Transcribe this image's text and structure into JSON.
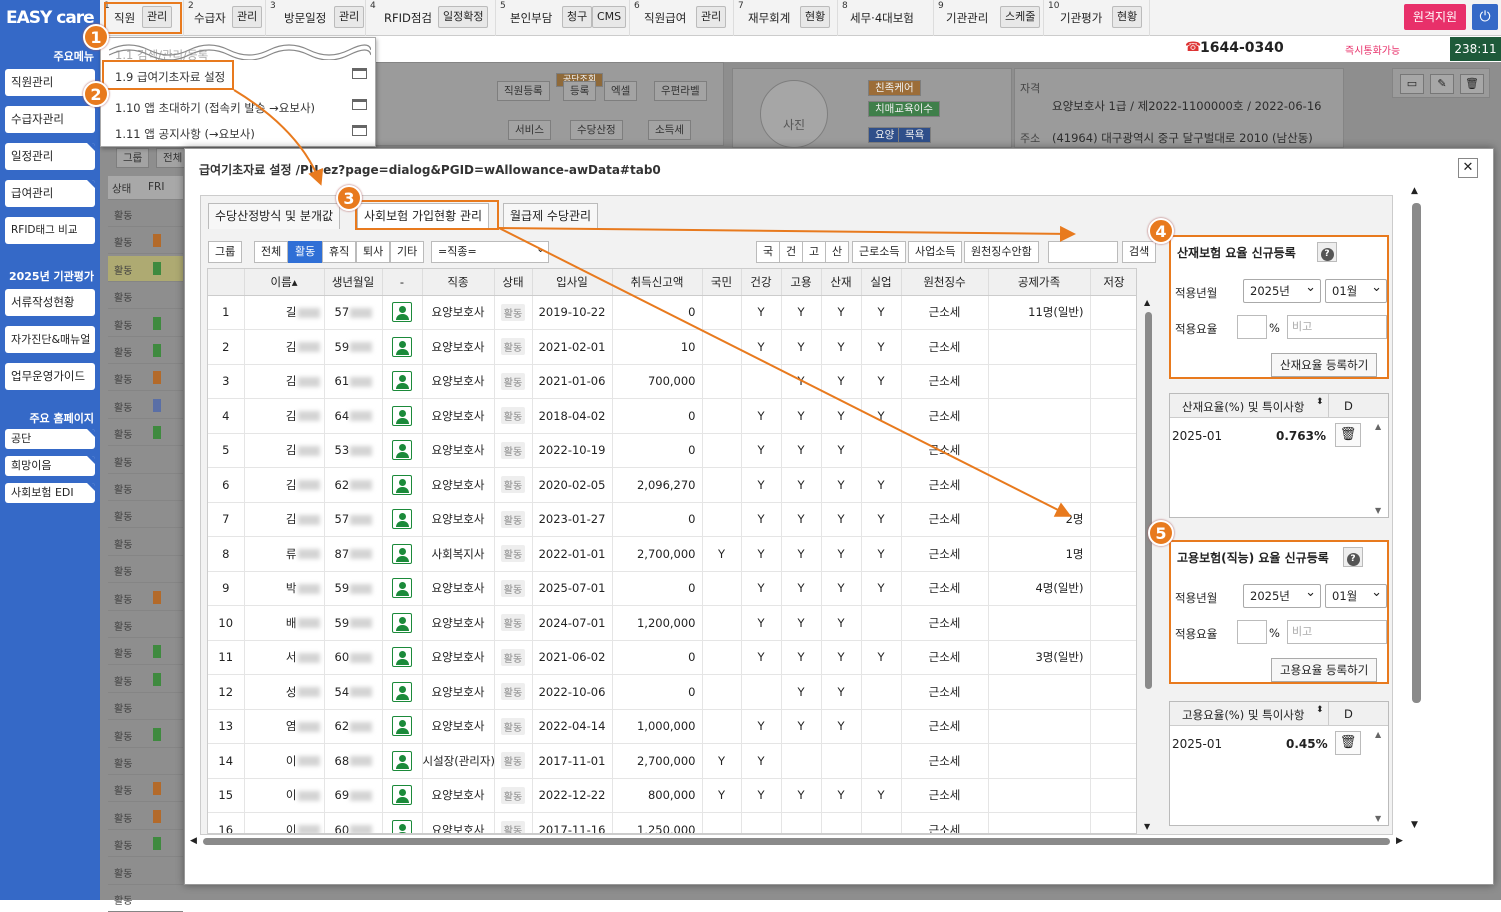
{
  "app": {
    "logo": "EASY care",
    "remote_support": "원격지원",
    "phone": "1644-0340",
    "call_status": "즉시통화가능",
    "clock": "238:11"
  },
  "sidebar": {
    "main_menu_title": "주요메뉴",
    "main_items": [
      "직원관리",
      "수급자관리",
      "일정관리",
      "급여관리",
      "RFID태그 비교"
    ],
    "eval_title": "2025년 기관평가",
    "eval_items": [
      "서류작성현황",
      "자가진단&매뉴얼",
      "업무운영가이드"
    ],
    "home_title": "주요 홈페이지",
    "home_items": [
      "공단",
      "희망이음",
      "사회보험 EDI"
    ]
  },
  "nav": [
    {
      "num": "1",
      "label": "직원",
      "btns": [
        "관리"
      ]
    },
    {
      "num": "2",
      "label": "수급자",
      "btns": [
        "관리"
      ]
    },
    {
      "num": "3",
      "label": "방문일정",
      "btns": [
        "관리"
      ]
    },
    {
      "num": "4",
      "label": "RFID점검",
      "btns": [
        "일정확정"
      ]
    },
    {
      "num": "5",
      "label": "본인부담",
      "btns": [
        "청구",
        "CMS"
      ]
    },
    {
      "num": "6",
      "label": "직원급여",
      "btns": [
        "관리"
      ]
    },
    {
      "num": "7",
      "label": "재무회계",
      "btns": [
        "현황"
      ]
    },
    {
      "num": "8",
      "label": "세무·4대보험",
      "btns": []
    },
    {
      "num": "9",
      "label": "기관관리",
      "btns": [
        "스케줄"
      ]
    },
    {
      "num": "10",
      "label": "기관평가",
      "btns": [
        "현황"
      ]
    }
  ],
  "dropdown": {
    "items": [
      "1.1 검색/관리/등록",
      "1.9 급여기초자료 설정",
      "1.10 앱 초대하기 (접속키 발송 →요보사)",
      "1.11 앱 공지사항 (→요보사)"
    ]
  },
  "background": {
    "buttons": [
      "직원등록",
      "공단조회",
      "등록",
      "엑셀",
      "우편라벨",
      "서비스",
      "수당산정",
      "소득세",
      "그룹",
      "전체"
    ],
    "photo": "사진",
    "tags": [
      "친족케어",
      "치매교육이수",
      "요양",
      "목욕"
    ],
    "qualification_label": "자격",
    "qualification": "요양보호사 1급 / 제2022-1100000호 / 2022-06-16",
    "address_label": "주소",
    "address": "(41964) 대구광역시 중구 달구벌대로 2010 (남산동)",
    "list_headers": [
      "상태",
      "FRI"
    ],
    "status_text": "활동"
  },
  "modal": {
    "title": "급여기초자료 설정 /PU.ez?page=dialog&PGID=wAllowance-awData#tab0",
    "tabs": [
      "수당산정방식 및 분개값",
      "사회보험 가입현황 관리",
      "월급제 수당관리"
    ],
    "filters": [
      "그룹",
      "전체",
      "활동",
      "휴직",
      "퇴사",
      "기타"
    ],
    "job_select": "=직종=",
    "ins_filters": [
      "국",
      "건",
      "고",
      "산",
      "근로소득",
      "사업소득",
      "원천징수안함"
    ],
    "search_label": "검색",
    "columns": [
      "",
      "이름",
      "생년월일",
      "-",
      "직종",
      "상태",
      "입사일",
      "취득신고액",
      "국민",
      "건강",
      "고용",
      "산재",
      "실업",
      "원천징수",
      "공제가족",
      "저장"
    ],
    "rows": [
      [
        "1",
        "길",
        "57",
        "",
        "요양보호사",
        "활동",
        "2019-10-22",
        "0",
        "",
        "Y",
        "Y",
        "Y",
        "Y",
        "근소세",
        "11명(일반)"
      ],
      [
        "2",
        "김",
        "59",
        "",
        "요양보호사",
        "활동",
        "2021-02-01",
        "10",
        "",
        "Y",
        "Y",
        "Y",
        "Y",
        "근소세",
        ""
      ],
      [
        "3",
        "김",
        "61",
        "",
        "요양보호사",
        "활동",
        "2021-01-06",
        "700,000",
        "",
        "",
        "Y",
        "Y",
        "Y",
        "근소세",
        ""
      ],
      [
        "4",
        "김",
        "64",
        "",
        "요양보호사",
        "활동",
        "2018-04-02",
        "0",
        "",
        "Y",
        "Y",
        "Y",
        "Y",
        "근소세",
        ""
      ],
      [
        "5",
        "김",
        "53",
        "",
        "요양보호사",
        "활동",
        "2022-10-19",
        "0",
        "",
        "Y",
        "Y",
        "Y",
        "",
        "근소세",
        ""
      ],
      [
        "6",
        "김",
        "62",
        "",
        "요양보호사",
        "활동",
        "2020-02-05",
        "2,096,270",
        "",
        "Y",
        "Y",
        "Y",
        "Y",
        "근소세",
        ""
      ],
      [
        "7",
        "김",
        "57",
        "",
        "요양보호사",
        "활동",
        "2023-01-27",
        "0",
        "",
        "Y",
        "Y",
        "Y",
        "Y",
        "근소세",
        "2명"
      ],
      [
        "8",
        "류",
        "87",
        "",
        "사회복지사",
        "활동",
        "2022-01-01",
        "2,700,000",
        "Y",
        "Y",
        "Y",
        "Y",
        "Y",
        "근소세",
        "1명"
      ],
      [
        "9",
        "박",
        "59",
        "",
        "요양보호사",
        "활동",
        "2025-07-01",
        "0",
        "",
        "Y",
        "Y",
        "Y",
        "Y",
        "근소세",
        "4명(일반)"
      ],
      [
        "10",
        "배",
        "59",
        "",
        "요양보호사",
        "활동",
        "2024-07-01",
        "1,200,000",
        "",
        "Y",
        "Y",
        "Y",
        "",
        "근소세",
        ""
      ],
      [
        "11",
        "서",
        "60",
        "",
        "요양보호사",
        "활동",
        "2021-06-02",
        "0",
        "",
        "Y",
        "Y",
        "Y",
        "Y",
        "근소세",
        "3명(일반)"
      ],
      [
        "12",
        "성",
        "54",
        "",
        "요양보호사",
        "활동",
        "2022-10-06",
        "0",
        "",
        "",
        "Y",
        "Y",
        "",
        "근소세",
        ""
      ],
      [
        "13",
        "염",
        "62",
        "",
        "요양보호사",
        "활동",
        "2022-04-14",
        "1,000,000",
        "",
        "Y",
        "Y",
        "Y",
        "",
        "근소세",
        ""
      ],
      [
        "14",
        "이",
        "68",
        "",
        "시설장(관리자)",
        "활동",
        "2017-11-01",
        "2,700,000",
        "Y",
        "Y",
        "",
        "",
        "",
        "근소세",
        ""
      ],
      [
        "15",
        "이",
        "69",
        "",
        "요양보호사",
        "활동",
        "2022-12-22",
        "800,000",
        "Y",
        "Y",
        "Y",
        "Y",
        "Y",
        "근소세",
        ""
      ],
      [
        "16",
        "이",
        "60",
        "",
        "요양보호사",
        "활동",
        "2017-11-16",
        "1,250,000",
        "",
        "",
        "",
        "",
        "",
        "근소세",
        ""
      ]
    ]
  },
  "sanjae": {
    "title": "산재보험 요율 신규등록",
    "year_label": "적용년월",
    "year": "2025년",
    "month": "01월",
    "rate_label": "적용요율",
    "percent": "%",
    "memo_placeholder": "비고",
    "button": "산재요율 등록하기",
    "list_header": "산재요율(%) 및 특이사항",
    "list_header_d": "D",
    "list": [
      {
        "ym": "2025-01",
        "rate": "0.763%"
      }
    ]
  },
  "goyong": {
    "title": "고용보험(직능) 요율 신규등록",
    "year_label": "적용년월",
    "year": "2025년",
    "month": "01월",
    "rate_label": "적용요율",
    "percent": "%",
    "memo_placeholder": "비고",
    "button": "고용요율 등록하기",
    "list_header": "고용요율(%) 및 특이사항",
    "list_header_d": "D",
    "list": [
      {
        "ym": "2025-01",
        "rate": "0.45%"
      }
    ]
  },
  "callouts": [
    "1",
    "2",
    "3",
    "4",
    "5"
  ],
  "colors": {
    "accent": "#e87a1e",
    "sidebar": "#3569c7",
    "active_filter": "#2f6fd6",
    "user_icon": "#1b8a3a"
  }
}
